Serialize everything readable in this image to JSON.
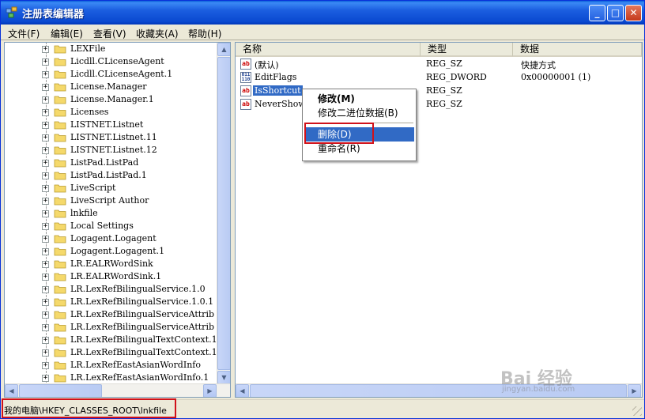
{
  "window": {
    "title": "注册表编辑器",
    "minimize_glyph": "_",
    "maximize_glyph": "□",
    "close_glyph": "✕"
  },
  "menubar": {
    "file": "文件(F)",
    "edit": "编辑(E)",
    "view": "查看(V)",
    "favorites": "收藏夹(A)",
    "help": "帮助(H)"
  },
  "tree": {
    "items": [
      {
        "label": "LEXFile"
      },
      {
        "label": "Licdll.CLicenseAgent"
      },
      {
        "label": "Licdll.CLicenseAgent.1"
      },
      {
        "label": "License.Manager"
      },
      {
        "label": "License.Manager.1"
      },
      {
        "label": "Licenses"
      },
      {
        "label": "LISTNET.Listnet"
      },
      {
        "label": "LISTNET.Listnet.11"
      },
      {
        "label": "LISTNET.Listnet.12"
      },
      {
        "label": "ListPad.ListPad"
      },
      {
        "label": "ListPad.ListPad.1"
      },
      {
        "label": "LiveScript"
      },
      {
        "label": "LiveScript Author"
      },
      {
        "label": "lnkfile"
      },
      {
        "label": "Local Settings"
      },
      {
        "label": "Logagent.Logagent"
      },
      {
        "label": "Logagent.Logagent.1"
      },
      {
        "label": "LR.EALRWordSink"
      },
      {
        "label": "LR.EALRWordSink.1"
      },
      {
        "label": "LR.LexRefBilingualService.1.0"
      },
      {
        "label": "LR.LexRefBilingualService.1.0.1"
      },
      {
        "label": "LR.LexRefBilingualServiceAttrib"
      },
      {
        "label": "LR.LexRefBilingualServiceAttrib"
      },
      {
        "label": "LR.LexRefBilingualTextContext.1"
      },
      {
        "label": "LR.LexRefBilingualTextContext.1"
      },
      {
        "label": "LR.LexRefEastAsianWordInfo"
      },
      {
        "label": "LR.LexRefEastAsianWordInfo.1"
      }
    ],
    "scroll_up": "▲",
    "scroll_down": "▼",
    "scroll_left": "◀",
    "scroll_right": "▶"
  },
  "list": {
    "columns": {
      "name": "名称",
      "type": "类型",
      "data": "数据"
    },
    "rows": [
      {
        "icon": "string-value-icon",
        "name": "(默认)",
        "type": "REG_SZ",
        "data": "快捷方式"
      },
      {
        "icon": "binary-value-icon",
        "name": "EditFlags",
        "type": "REG_DWORD",
        "data": "0x00000001 (1)"
      },
      {
        "icon": "string-value-icon",
        "name": "IsShortcut",
        "type": "REG_SZ",
        "data": ""
      },
      {
        "icon": "string-value-icon",
        "name": "NeverShowExt",
        "type": "REG_SZ",
        "data": ""
      }
    ],
    "scroll_left": "◀",
    "scroll_right": "▶"
  },
  "context_menu": {
    "modify": "修改(M)",
    "modify_binary": "修改二进位数据(B)",
    "delete": "删除(D)",
    "rename": "重命名(R)"
  },
  "statusbar": {
    "path": "我的电脑\\HKEY_CLASSES_ROOT\\lnkfile"
  },
  "watermark": {
    "main": "Bai 经验",
    "sub": "jingyan.baidu.com"
  },
  "colors": {
    "titlebar": "#0a49d0",
    "selection": "#316ac5",
    "annotation_red": "#d0111a"
  }
}
